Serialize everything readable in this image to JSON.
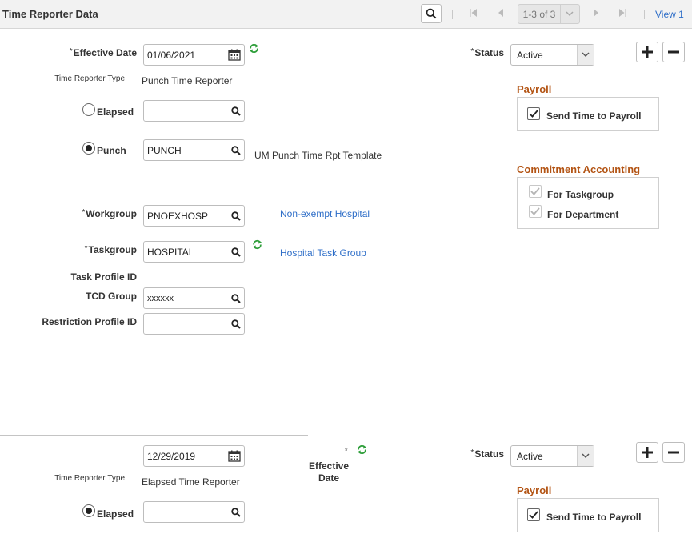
{
  "header": {
    "title": "Time Reporter Data",
    "counter": "1-3 of 3",
    "view_link": "View 1"
  },
  "row1": {
    "effective_date_label": "Effective Date",
    "effective_date_value": "01/06/2021",
    "status_label": "Status",
    "status_value": "Active",
    "time_reporter_type_label": "Time Reporter Type",
    "time_reporter_type_value": "Punch Time Reporter",
    "elapsed_label": "Elapsed",
    "elapsed_value": "",
    "punch_label": "Punch",
    "punch_value": "PUNCH",
    "punch_description": "UM Punch Time Rpt Template",
    "workgroup_label": "Workgroup",
    "workgroup_value": "PNOEXHOSP",
    "workgroup_description": "Non-exempt Hospital",
    "taskgroup_label": "Taskgroup",
    "taskgroup_value": "HOSPITAL",
    "taskgroup_description": "Hospital Task Group",
    "task_profile_label": "Task Profile ID",
    "tcd_group_label": "TCD Group",
    "tcd_group_value": "xxxxxx",
    "restriction_label": "Restriction Profile ID",
    "restriction_value": "",
    "payroll_title": "Payroll",
    "send_time_label": "Send Time to Payroll",
    "commitment_title": "Commitment Accounting",
    "for_taskgroup_label": "For Taskgroup",
    "for_department_label": "For Department"
  },
  "row2": {
    "effective_date_value": "12/29/2019",
    "effective_label_line1": "Effective",
    "effective_label_line2": "Date",
    "status_label": "Status",
    "status_value": "Active",
    "time_reporter_type_label": "Time Reporter Type",
    "time_reporter_type_value": "Elapsed Time Reporter",
    "elapsed_label": "Elapsed",
    "elapsed_value": "",
    "payroll_title": "Payroll",
    "send_time_label": "Send Time to Payroll"
  },
  "required_mark": "*",
  "colors": {
    "link": "#2e6ec8",
    "group_title": "#b35414",
    "refresh_icon": "#2e9e3a"
  }
}
